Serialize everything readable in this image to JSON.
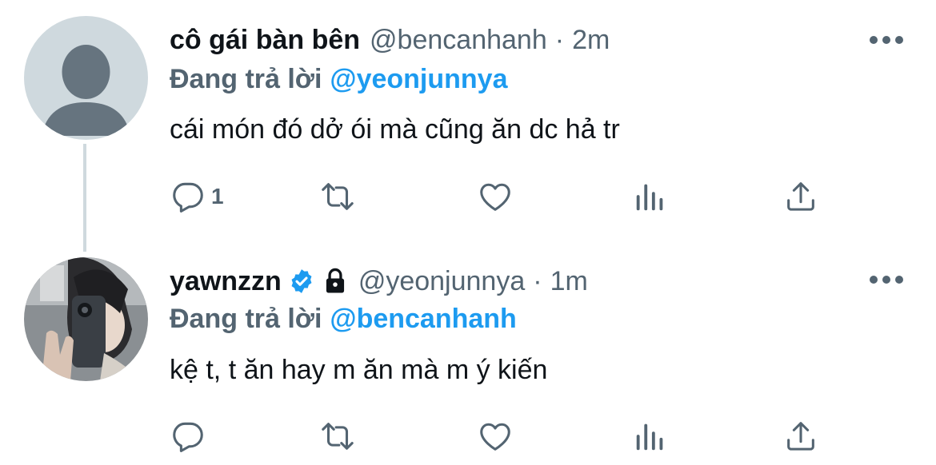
{
  "tweets": [
    {
      "display_name": "cô gái bàn bên",
      "handle": "@bencanhanh",
      "separator": "·",
      "time": "2m",
      "reply_prefix": "Đang trả lời",
      "reply_to": "@yeonjunnya",
      "text": "cái món đó dở ói mà cũng ăn dc hả tr",
      "reply_count": "1",
      "avatar": "default-avatar"
    },
    {
      "display_name": "yawnzzn",
      "handle": "@yeonjunnya",
      "separator": "·",
      "time": "1m",
      "reply_prefix": "Đang trả lời",
      "reply_to": "@bencanhanh",
      "text": "kệ t, t ăn hay m ăn mà m ý kiến",
      "reply_count": "",
      "verified": true,
      "protected": true,
      "avatar": "photo-avatar"
    }
  ],
  "colors": {
    "link": "#1d9bf0",
    "secondary_text": "#536471",
    "primary_text": "#0f1419",
    "icon": "#536471",
    "thread_line": "#cfd9de"
  }
}
